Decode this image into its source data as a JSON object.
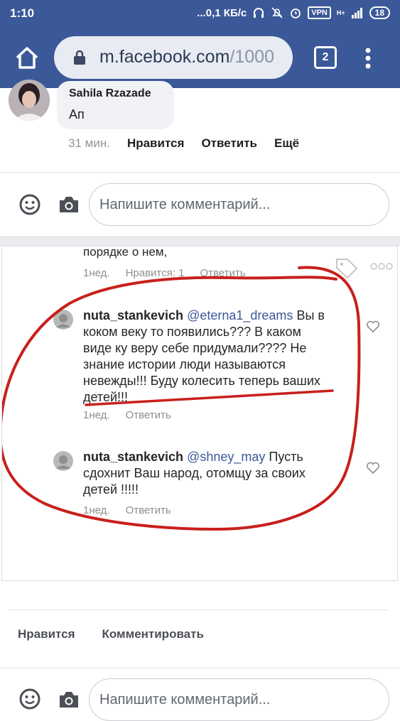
{
  "status_bar": {
    "time": "1:10",
    "network_speed": "...0,1 КБ/с",
    "vpn_label": "VPN",
    "signal_label": "H+",
    "battery": "18"
  },
  "browser": {
    "url_host": "m.facebook.com",
    "url_path": "/1000",
    "tab_count": "2"
  },
  "top_comment": {
    "author": "Sahila Rzazade",
    "text": "Ап",
    "time": "31 мин.",
    "like": "Нравится",
    "reply": "Ответить",
    "more": "Ещё"
  },
  "composer": {
    "placeholder": "Напишите комментарий..."
  },
  "screenshot_post": {
    "cut_top_text": "порядке о нем,",
    "top_meta": {
      "time": "1нед.",
      "likes": "Нравится: 1",
      "reply": "Ответить"
    },
    "comments": [
      {
        "username": "nuta_stankevich",
        "mention": "@eterna1_dreams",
        "lines": [
          " Вы в",
          "коком веку то появились??? В каком",
          "виде ку веру себе придумали???? Не",
          "знание истории люди называются",
          "невежды!!! Буду колесить теперь ваших",
          "детей!!!"
        ],
        "time": "1нед.",
        "reply": "Ответить"
      },
      {
        "username": "nuta_stankevich",
        "mention": "@shney_may",
        "lines": [
          " Пусть",
          "сдохнит Ваш народ, отомщу за своих",
          "детей !!!!!"
        ],
        "time": "1нед.",
        "reply": "Ответить"
      }
    ]
  },
  "post_actions": {
    "like": "Нравится",
    "comment": "Комментировать"
  },
  "colors": {
    "facebook_blue": "#3b5998",
    "annotation_red": "#c8201c"
  }
}
